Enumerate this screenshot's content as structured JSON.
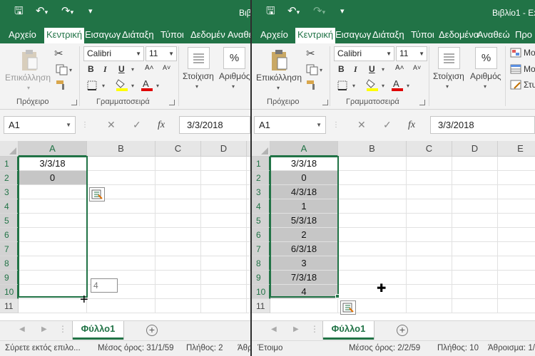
{
  "left": {
    "title": "Βιβ",
    "tabs": [
      "Αρχείο",
      "Κεντρική",
      "Εισαγωγ",
      "Διάταξη",
      "Τύποι",
      "Δεδομέν",
      "Αναθεω"
    ],
    "ribbon": {
      "paste": "Επικόλληση",
      "clipboard": "Πρόχειρο",
      "font_name": "Calibri",
      "font_size": "11",
      "font_group": "Γραμματοσειρά",
      "alignment": "Στοίχιση",
      "number": "Αριθμός"
    },
    "name_box": "A1",
    "formula": "3/3/2018",
    "columns": [
      "A",
      "B",
      "C",
      "D"
    ],
    "rows": [
      "1",
      "2",
      "3",
      "4",
      "5",
      "6",
      "7",
      "8",
      "9",
      "10",
      "11"
    ],
    "cells": [
      [
        "3/3/18"
      ],
      [
        "0"
      ]
    ],
    "fill_tooltip": "4",
    "sheet_tab": "Φύλλο1",
    "status": {
      "mode": "Σύρετε εκτός επιλο...",
      "average": "Μέσος όρος: 31/1/59",
      "count": "Πλήθος: 2",
      "sum": "Άθρ"
    }
  },
  "right": {
    "title": "Βιβλίο1 - Ex",
    "tabs": [
      "Αρχείο",
      "Κεντρική",
      "Εισαγωγ",
      "Διάταξη",
      "Τύποι",
      "Δεδομένα",
      "Αναθεώ",
      "Προ"
    ],
    "ribbon": {
      "paste": "Επικόλληση",
      "clipboard": "Πρόχειρο",
      "font_name": "Calibri",
      "font_size": "11",
      "font_group": "Γραμματοσειρά",
      "alignment": "Στοίχιση",
      "number": "Αριθμός",
      "cond_format": "Μο",
      "format_table": "Μο",
      "cell_styles": "Στυ"
    },
    "name_box": "A1",
    "formula": "3/3/2018",
    "columns": [
      "A",
      "B",
      "C",
      "D",
      "E"
    ],
    "rows": [
      "1",
      "2",
      "3",
      "4",
      "5",
      "6",
      "7",
      "8",
      "9",
      "10",
      "11"
    ],
    "cells": [
      [
        "3/3/18"
      ],
      [
        "0"
      ],
      [
        "4/3/18"
      ],
      [
        "1"
      ],
      [
        "5/3/18"
      ],
      [
        "2"
      ],
      [
        "6/3/18"
      ],
      [
        "3"
      ],
      [
        "7/3/18"
      ],
      [
        "4"
      ]
    ],
    "sheet_tab": "Φύλλο1",
    "status": {
      "mode": "Έτοιμο",
      "average": "Μέσος όρος: 2/2/59",
      "count": "Πλήθος: 10",
      "sum": "Άθροισμα: 1/"
    }
  }
}
